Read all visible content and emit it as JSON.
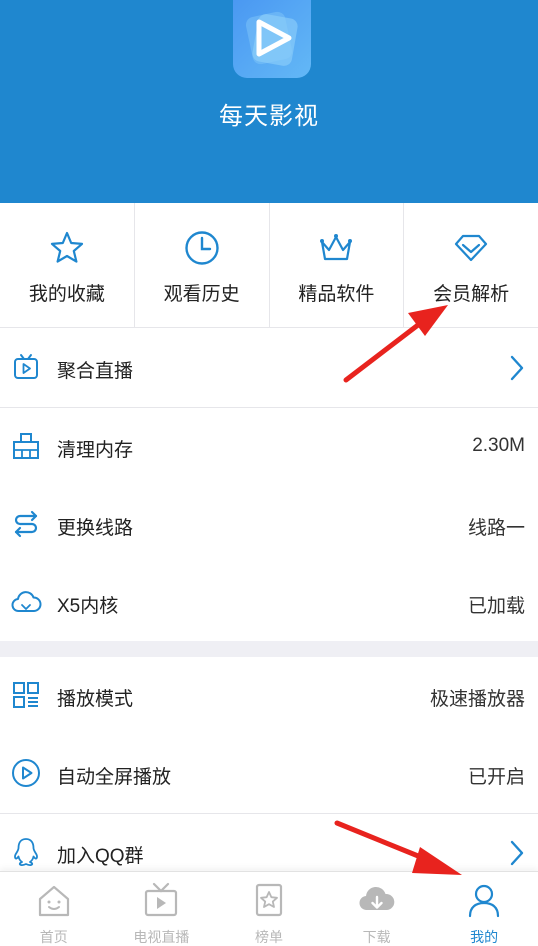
{
  "app": {
    "title": "每天影视"
  },
  "quick": [
    {
      "label": "我的收藏",
      "icon": "star-icon"
    },
    {
      "label": "观看历史",
      "icon": "clock-icon"
    },
    {
      "label": "精品软件",
      "icon": "crown-icon"
    },
    {
      "label": "会员解析",
      "icon": "diamond-icon"
    }
  ],
  "menu": [
    {
      "label": "聚合直播",
      "value": "",
      "icon": "tv-play-icon",
      "chevron": true
    },
    {
      "label": "清理内存",
      "value": "2.30M",
      "icon": "broom-icon"
    },
    {
      "label": "更换线路",
      "value": "线路一",
      "icon": "switch-route-icon"
    },
    {
      "label": "X5内核",
      "value": "已加载",
      "icon": "cloud-icon"
    },
    {
      "label": "播放模式",
      "value": "极速播放器",
      "icon": "grid-icon"
    },
    {
      "label": "自动全屏播放",
      "value": "已开启",
      "icon": "play-circle-icon"
    },
    {
      "label": "加入QQ群",
      "value": "",
      "icon": "qq-icon",
      "chevron": true
    }
  ],
  "tabs": [
    {
      "label": "首页",
      "icon": "home-icon",
      "active": false
    },
    {
      "label": "电视直播",
      "icon": "tv-icon",
      "active": false
    },
    {
      "label": "榜单",
      "icon": "ranking-icon",
      "active": false
    },
    {
      "label": "下载",
      "icon": "download-cloud-icon",
      "active": false
    },
    {
      "label": "我的",
      "icon": "user-icon",
      "active": true
    }
  ],
  "colors": {
    "header": "#1f87cf",
    "accent": "#1f87cf",
    "annotation_arrow": "#e8231e",
    "inactive_tab": "#b8b8b8"
  }
}
